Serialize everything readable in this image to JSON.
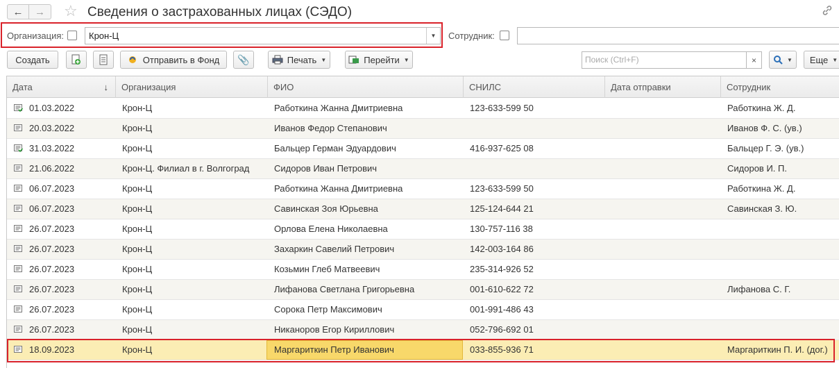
{
  "window": {
    "title": "Сведения о застрахованных лицах (СЭДО)"
  },
  "filters": {
    "org_label": "Организация:",
    "org_value": "Крон-Ц",
    "employee_label": "Сотрудник:",
    "employee_value": ""
  },
  "toolbar": {
    "create_label": "Создать",
    "send_label": "Отправить в Фонд",
    "print_label": "Печать",
    "goto_label": "Перейти",
    "search_placeholder": "Поиск (Ctrl+F)",
    "more_label": "Еще"
  },
  "table": {
    "columns": [
      "Дата",
      "Организация",
      "ФИО",
      "СНИЛС",
      "Дата отправки",
      "Сотрудник"
    ],
    "rows": [
      {
        "sent": true,
        "date": "01.03.2022",
        "org": "Крон-Ц",
        "fio": "Работкина Жанна Дмитриевна",
        "snils": "123-633-599 50",
        "sent_date": "",
        "employee": "Работкина Ж. Д."
      },
      {
        "sent": false,
        "date": "20.03.2022",
        "org": "Крон-Ц",
        "fio": "Иванов Федор Степанович",
        "snils": "",
        "sent_date": "",
        "employee": "Иванов Ф. С. (ув.)"
      },
      {
        "sent": true,
        "date": "31.03.2022",
        "org": "Крон-Ц",
        "fio": "Бальцер Герман Эдуардович",
        "snils": "416-937-625 08",
        "sent_date": "",
        "employee": "Бальцер Г. Э. (ув.)"
      },
      {
        "sent": false,
        "date": "21.06.2022",
        "org": "Крон-Ц. Филиал в г. Волгоград",
        "fio": "Сидоров Иван Петрович",
        "snils": "",
        "sent_date": "",
        "employee": "Сидоров И. П."
      },
      {
        "sent": false,
        "date": "06.07.2023",
        "org": "Крон-Ц",
        "fio": "Работкина Жанна Дмитриевна",
        "snils": "123-633-599 50",
        "sent_date": "",
        "employee": "Работкина Ж. Д."
      },
      {
        "sent": false,
        "date": "06.07.2023",
        "org": "Крон-Ц",
        "fio": "Савинская Зоя Юрьевна",
        "snils": "125-124-644 21",
        "sent_date": "",
        "employee": "Савинская З. Ю."
      },
      {
        "sent": false,
        "date": "26.07.2023",
        "org": "Крон-Ц",
        "fio": "Орлова Елена Николаевна",
        "snils": "130-757-116 38",
        "sent_date": "",
        "employee": ""
      },
      {
        "sent": false,
        "date": "26.07.2023",
        "org": "Крон-Ц",
        "fio": "Захаркин Савелий Петрович",
        "snils": "142-003-164 86",
        "sent_date": "",
        "employee": ""
      },
      {
        "sent": false,
        "date": "26.07.2023",
        "org": "Крон-Ц",
        "fio": "Козьмин Глеб Матвеевич",
        "snils": "235-314-926 52",
        "sent_date": "",
        "employee": ""
      },
      {
        "sent": false,
        "date": "26.07.2023",
        "org": "Крон-Ц",
        "fio": "Лифанова Светлана Григорьевна",
        "snils": "001-610-622 72",
        "sent_date": "",
        "employee": "Лифанова С. Г."
      },
      {
        "sent": false,
        "date": "26.07.2023",
        "org": "Крон-Ц",
        "fio": "Сорока Петр Максимович",
        "snils": "001-991-486 43",
        "sent_date": "",
        "employee": ""
      },
      {
        "sent": false,
        "date": "26.07.2023",
        "org": "Крон-Ц",
        "fio": "Никаноров Егор Кириллович",
        "snils": "052-796-692 01",
        "sent_date": "",
        "employee": ""
      },
      {
        "sent": false,
        "date": "18.09.2023",
        "org": "Крон-Ц",
        "fio": "Маргариткин Петр Иванович",
        "snils": "033-855-936 71",
        "sent_date": "",
        "employee": "Маргариткин П. И. (дог.)",
        "selected": true
      }
    ]
  }
}
